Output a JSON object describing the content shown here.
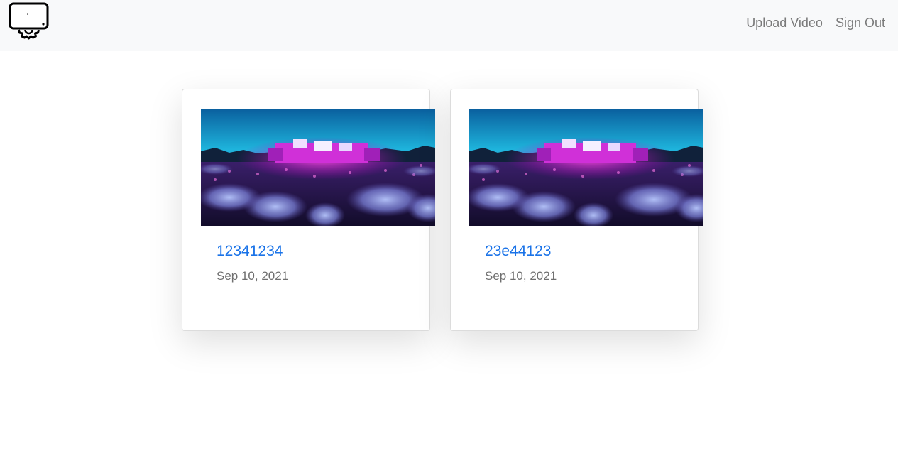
{
  "navbar": {
    "logo_icon": "monitor-gear-icon",
    "links": [
      {
        "label": "Upload Video"
      },
      {
        "label": "Sign Out"
      }
    ]
  },
  "videos": [
    {
      "title": "12341234",
      "date": "Sep 10, 2021",
      "thumbnail_icon": "concert-stage-image"
    },
    {
      "title": "23e44123",
      "date": "Sep 10, 2021",
      "thumbnail_icon": "concert-stage-image"
    }
  ],
  "colors": {
    "link_blue": "#1a73e8",
    "nav_bg": "#f8f9fa",
    "nav_text": "#7a7a7a",
    "date_text": "#6f6f6f"
  }
}
